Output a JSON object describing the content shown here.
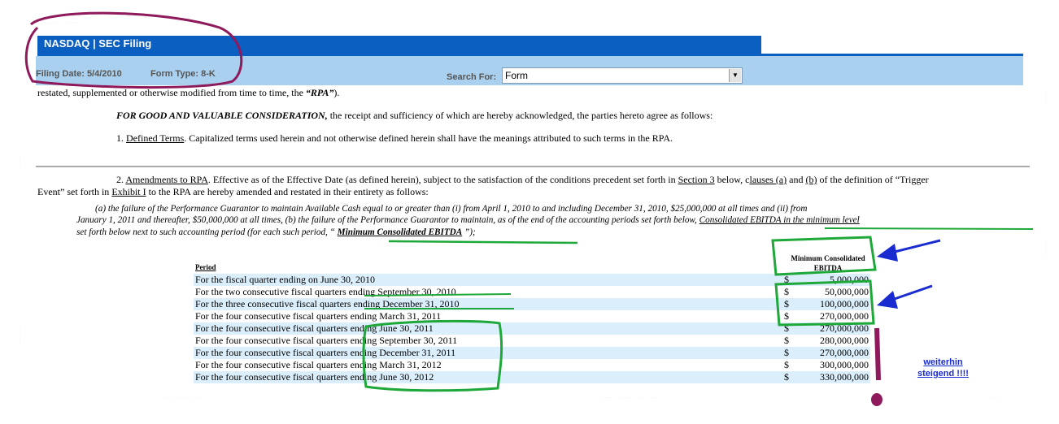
{
  "header": {
    "title": "NASDAQ | SEC Filing",
    "filing_date": "Filing Date: 5/4/2010",
    "form_type": "Form Type: 8-K",
    "search_label": "Search For:",
    "search_value": "Form"
  },
  "document": {
    "line_cut": "restated, supplemented or otherwise modified from time to time, the ",
    "line_cut_bold": "“RPA”",
    "line_cut_end": ").",
    "consideration_bold": "FOR GOOD AND VALUABLE CONSIDERATION,",
    "consideration_rest": " the receipt and sufficiency of which are hereby acknowledged, the parties hereto agree as follows:",
    "s1_num": "1. ",
    "s1_term": "Defined Terms",
    "s1_rest": ". Capitalized terms used herein and not otherwise defined herein shall have the meanings attributed to such terms in the RPA.",
    "s2_num": "2. ",
    "s2_term": "Amendments to RPA",
    "s2_a": ". Effective as of the Effective Date (as defined herein), subject to the satisfaction of the conditions precedent set forth in ",
    "s2_sec3": "Section 3",
    "s2_b": " below, c",
    "s2_lauses_a": "lauses (a)",
    "s2_and": " and ",
    "s2_b_ref": "(b)",
    "s2_c": " of the definition of “Trigger",
    "s2_line2a": "Event” set forth in ",
    "s2_exhibit": "Exhibit I",
    "s2_line2b": " to the RPA are hereby amended and restated in their entirety as follows:",
    "quote_l1": "(a) the failure of the Performance Guarantor to maintain Available Cash equal to or greater than (i) from April 1, 2010 to and including December 31, 2010, $25,000,000 at all times and (ii) from",
    "quote_l2a": "January 1, 2011 and thereafter, $50,000,000 at all times, (b) the failure of the Performance Guarantor to maintain, as of the end of the accounting periods set forth below, ",
    "quote_l2b": "Consolidated EBITDA in the minimum level",
    "quote_l3a": "set forth below next to such accounting period (for each such period, “ ",
    "quote_l3b": "Minimum Consolidated EBITDA",
    "quote_l3c": " ”);"
  },
  "table": {
    "col_period": "Period",
    "col_ebitda_l1": "Minimum Consolidated",
    "col_ebitda_l2": "EBITDA",
    "rows": [
      {
        "period": "For the fiscal quarter ending on June 30, 2010",
        "cur": "$",
        "value": "5,000,000"
      },
      {
        "period": "For the two consecutive fiscal quarters ending September 30, 2010",
        "cur": "$",
        "value": "50,000,000"
      },
      {
        "period": "For the three consecutive fiscal quarters ending December 31, 2010",
        "cur": "$",
        "value": "100,000,000"
      },
      {
        "period": "For the four consecutive fiscal quarters ending March 31, 2011",
        "cur": "$",
        "value": "270,000,000"
      },
      {
        "period": "For the four consecutive fiscal quarters ending June 30, 2011",
        "cur": "$",
        "value": "270,000,000"
      },
      {
        "period": "For the four consecutive fiscal quarters ending September 30, 2011",
        "cur": "$",
        "value": "280,000,000"
      },
      {
        "period": "For the four consecutive fiscal quarters ending December 31, 2011",
        "cur": "$",
        "value": "270,000,000"
      },
      {
        "period": "For the four consecutive fiscal quarters ending March 31, 2012",
        "cur": "$",
        "value": "300,000,000"
      },
      {
        "period": "For the four consecutive fiscal quarters ending June 30, 2012",
        "cur": "$",
        "value": "330,000,000"
      }
    ]
  },
  "annotation": {
    "note_l1": "weiterhin",
    "note_l2": "steigend !!!!"
  },
  "colors": {
    "nasdaq_blue": "#0b5fc1",
    "filter_bar": "#a9d0ee",
    "row_shade": "#dbeefb",
    "marker_green": "#1fa83a",
    "marker_purple": "#8e1a5c",
    "arrow_blue": "#1a2bd0"
  }
}
